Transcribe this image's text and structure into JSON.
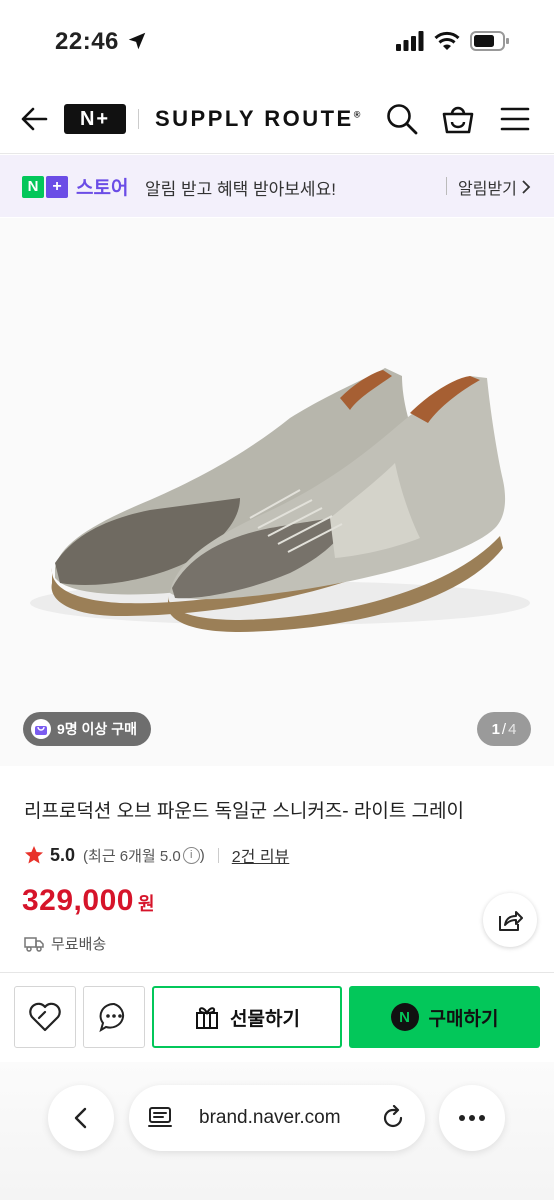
{
  "status": {
    "time": "22:46"
  },
  "header": {
    "logo": "N+",
    "brand": "SUPPLY ROUTE",
    "brand_mark": "®"
  },
  "promo": {
    "badge_n": "N",
    "badge_plus": "+",
    "store": "스토어",
    "message": "알림 받고 혜택 받아보세요!",
    "link_label": "알림받기"
  },
  "hero": {
    "badge_label": "9명 이상 구매",
    "page_current": "1",
    "page_separator": "/",
    "page_total": "4"
  },
  "product": {
    "title": "리프로덕션 오브 파운드 독일군 스니커즈- 라이트 그레이",
    "rating": "5.0",
    "recent_rating": "(최근 6개월 5.0",
    "recent_close": ")",
    "info_glyph": "i",
    "review_count": "2건 리뷰",
    "price": "329,000",
    "currency": "원",
    "shipping": "무료배송"
  },
  "actions": {
    "gift_label": "선물하기",
    "buy_label": "구매하기",
    "buy_badge": "N"
  },
  "browser": {
    "url": "brand.naver.com"
  },
  "colors": {
    "naver_green": "#03c75a",
    "plus_purple": "#6b4de6",
    "price_red": "#d6142a"
  },
  "icons": [
    "location-arrow-icon",
    "signal-icon",
    "wifi-icon",
    "battery-icon",
    "back-arrow-icon",
    "search-icon",
    "cart-icon",
    "menu-icon",
    "chevron-right-icon",
    "bag-icon",
    "star-icon",
    "info-icon",
    "truck-icon",
    "share-icon",
    "heart-icon",
    "chat-icon",
    "gift-icon",
    "browser-back-icon",
    "reader-icon",
    "reload-icon",
    "more-icon"
  ]
}
